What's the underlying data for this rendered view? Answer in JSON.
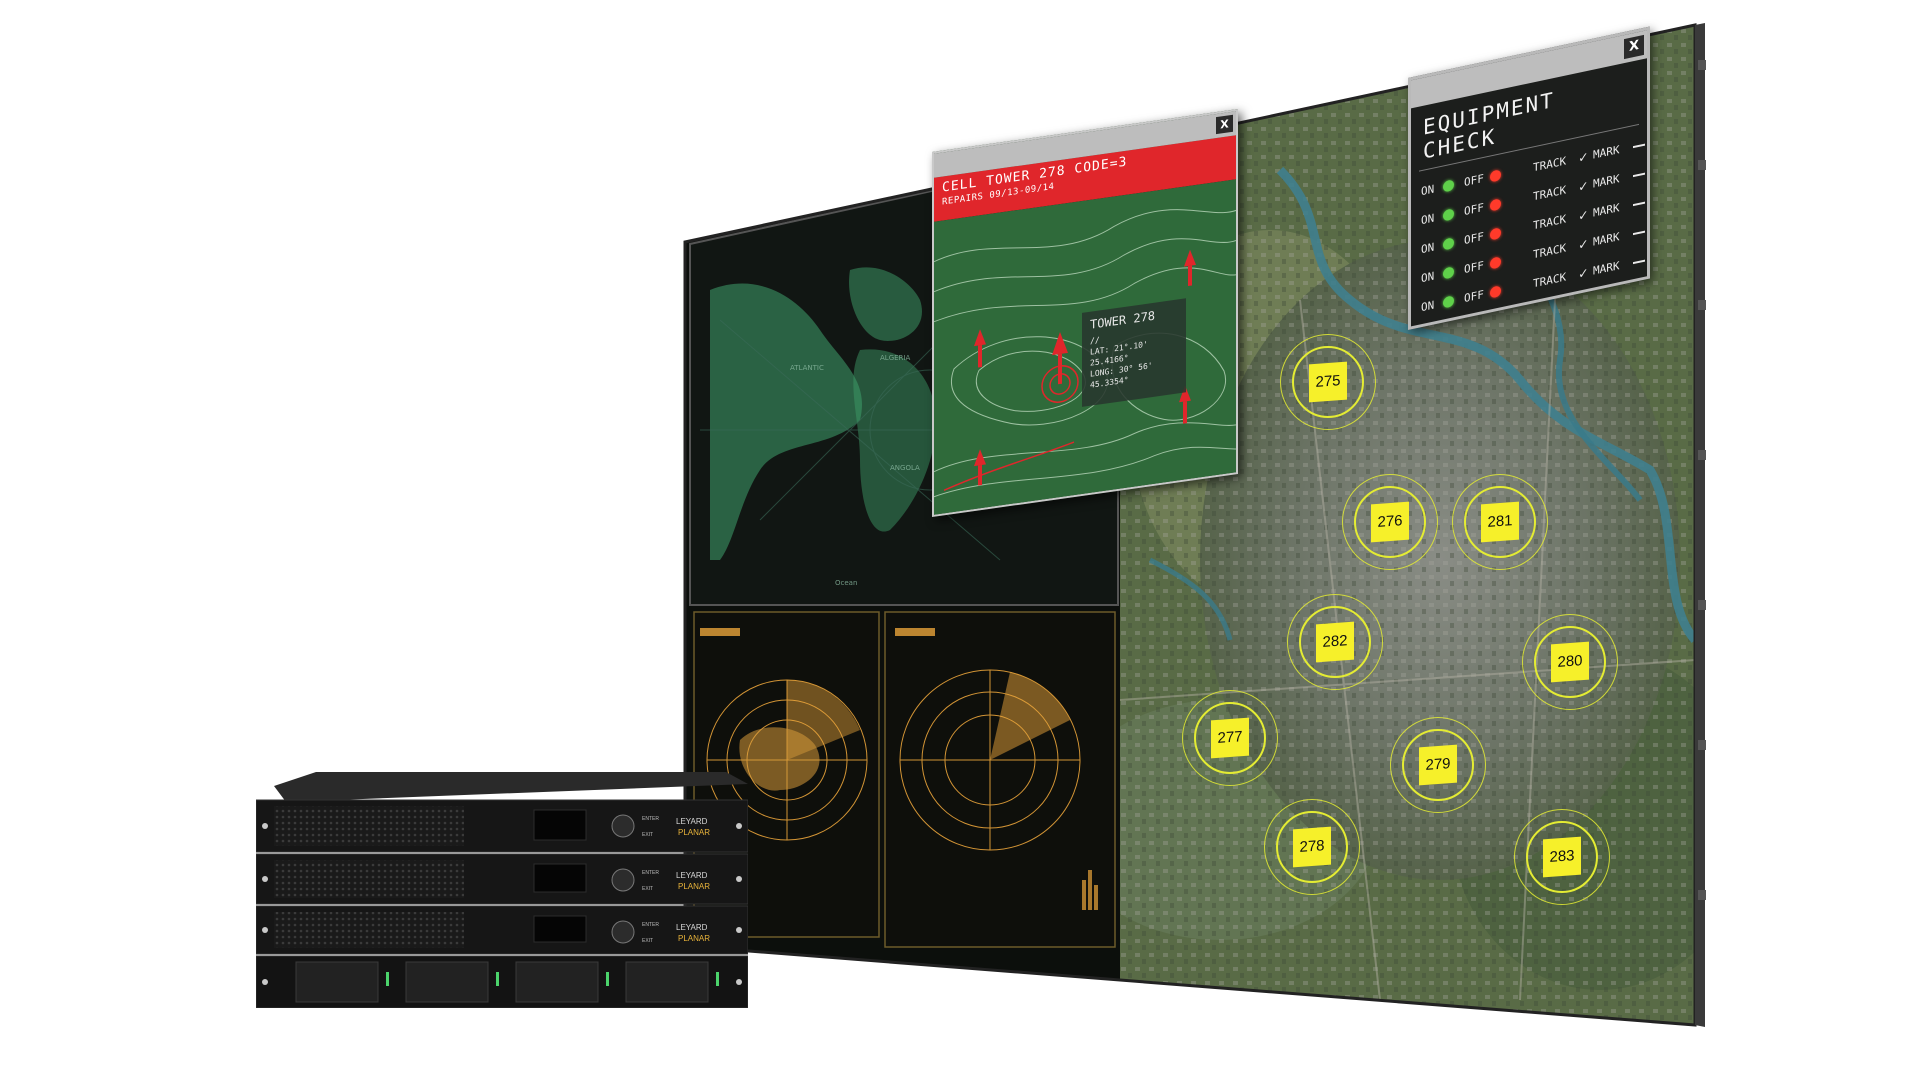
{
  "tower_popup": {
    "close_label": "X",
    "title": "CELL TOWER 278 CODE=3",
    "subtitle": "REPAIRS 09/13-09/14",
    "label": {
      "name": "TOWER 278",
      "lines": [
        "//",
        "LAT: 21°.10'",
        "25.4166°",
        "LONG: 30° 56'",
        "45.3354°"
      ]
    }
  },
  "equipment_check": {
    "close_label": "X",
    "title": "EQUIPMENT CHECK",
    "rows": [
      {
        "on": "ON",
        "off": "OFF",
        "track": "TRACK",
        "check": "✓",
        "mark": "MARK"
      },
      {
        "on": "ON",
        "off": "OFF",
        "track": "TRACK",
        "check": "✓",
        "mark": "MARK"
      },
      {
        "on": "ON",
        "off": "OFF",
        "track": "TRACK",
        "check": "✓",
        "mark": "MARK"
      },
      {
        "on": "ON",
        "off": "OFF",
        "track": "TRACK",
        "check": "✓",
        "mark": "MARK"
      },
      {
        "on": "ON",
        "off": "OFF",
        "track": "TRACK",
        "check": "✓",
        "mark": "MARK"
      }
    ]
  },
  "markers": [
    "275",
    "276",
    "281",
    "282",
    "280",
    "277",
    "279",
    "278",
    "283"
  ],
  "rack": {
    "brand": "LEYARD",
    "product": "PLANAR",
    "btn_enter": "ENTER",
    "btn_exit": "EXIT"
  },
  "colors": {
    "alert_red": "#e0262b",
    "marker_yellow": "#f6f02a",
    "radar_orange": "#e8a33a",
    "world_map_green": "#4fd08a",
    "on_green": "#5fd14a",
    "off_red": "#ff3a2a"
  }
}
